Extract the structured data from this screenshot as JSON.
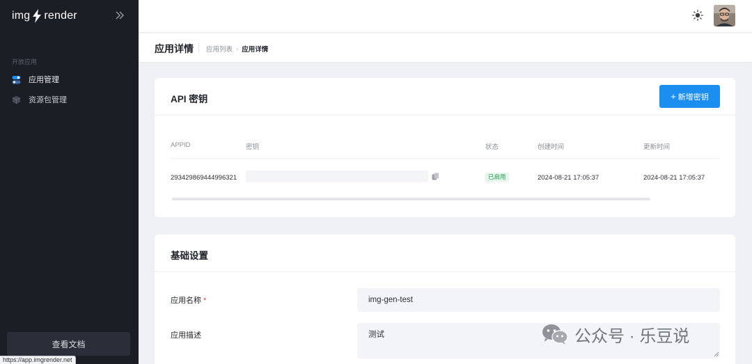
{
  "sidebar": {
    "logo_left": "img",
    "logo_right": "render",
    "section_label": "开放应用",
    "items": [
      {
        "label": "应用管理",
        "active": true
      },
      {
        "label": "资源包管理",
        "active": false
      }
    ],
    "docs_button": "查看文档",
    "status_url": "https://app.imgrender.net"
  },
  "header": {
    "title": "应用详情",
    "breadcrumb": [
      "应用列表",
      "应用详情"
    ]
  },
  "api_keys": {
    "title": "API 密钥",
    "add_button": "新增密钥",
    "columns": [
      "APPID",
      "密钥",
      "状态",
      "创建时间",
      "更新时间"
    ],
    "rows": [
      {
        "appid": "293429869444996321",
        "secret": "",
        "status": "已启用",
        "created": "2024-08-21 17:05:37",
        "updated": "2024-08-21 17:05:37"
      }
    ]
  },
  "basic": {
    "title": "基础设置",
    "name_label": "应用名称",
    "name_required": "*",
    "name_value": "img-gen-test",
    "desc_label": "应用描述",
    "desc_value": "测试"
  },
  "watermark": {
    "text": "公众号 · 乐豆说"
  },
  "colors": {
    "sidebar_bg": "#1c1e26",
    "primary": "#1b8ef0",
    "status_green": "#1f9d4f",
    "page_bg": "#eef0f3"
  },
  "icons": {
    "logo": "lightning-bolt-icon",
    "collapse": "double-chevron-right-icon",
    "apps": "toggle-icon",
    "packs": "cube-icon",
    "theme": "sun-icon",
    "copy": "copy-icon"
  }
}
